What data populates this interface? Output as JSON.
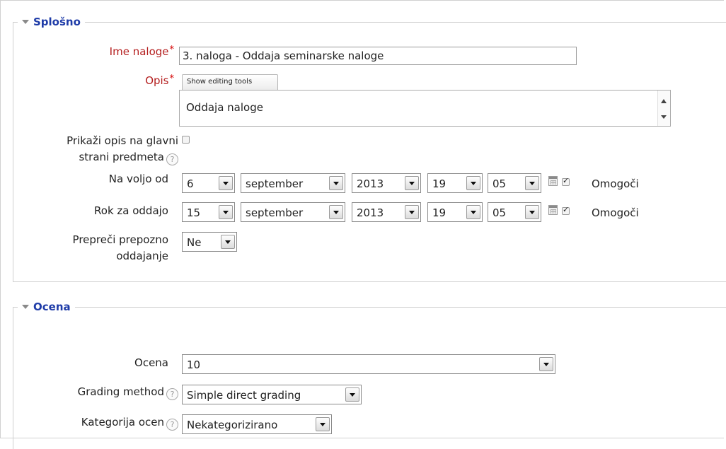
{
  "general": {
    "legend": "Splošno",
    "name_label": "Ime naloge",
    "name_value": "3. naloga - Oddaja seminarske naloge",
    "desc_label": "Opis",
    "show_tools": "Show editing tools",
    "desc_value": "Oddaja naloge",
    "show_desc_label_1": "Prikaži opis na glavni",
    "show_desc_label_2": "strani predmeta",
    "show_desc_checked": false,
    "allow_from": {
      "label": "Na voljo od",
      "day": "6",
      "month": "september",
      "year": "2013",
      "hour": "19",
      "minute": "05",
      "enable_label": "Omogoči",
      "enabled": true
    },
    "due": {
      "label": "Rok za oddajo",
      "day": "15",
      "month": "september",
      "year": "2013",
      "hour": "19",
      "minute": "05",
      "enable_label": "Omogoči",
      "enabled": true
    },
    "prevent_late_1": "Prepreči prepozno",
    "prevent_late_2": "oddajanje",
    "prevent_late_value": "Ne"
  },
  "grade": {
    "legend": "Ocena",
    "grade_label": "Ocena",
    "grade_value": "10",
    "method_label": "Grading method",
    "method_value": "Simple direct grading",
    "category_label": "Kategorija ocen",
    "category_value": "Nekategorizirano"
  },
  "icons": {
    "help": "?",
    "required": "*"
  },
  "colors": {
    "legend": "#1f3ca8",
    "required_label": "#b41e1e"
  }
}
